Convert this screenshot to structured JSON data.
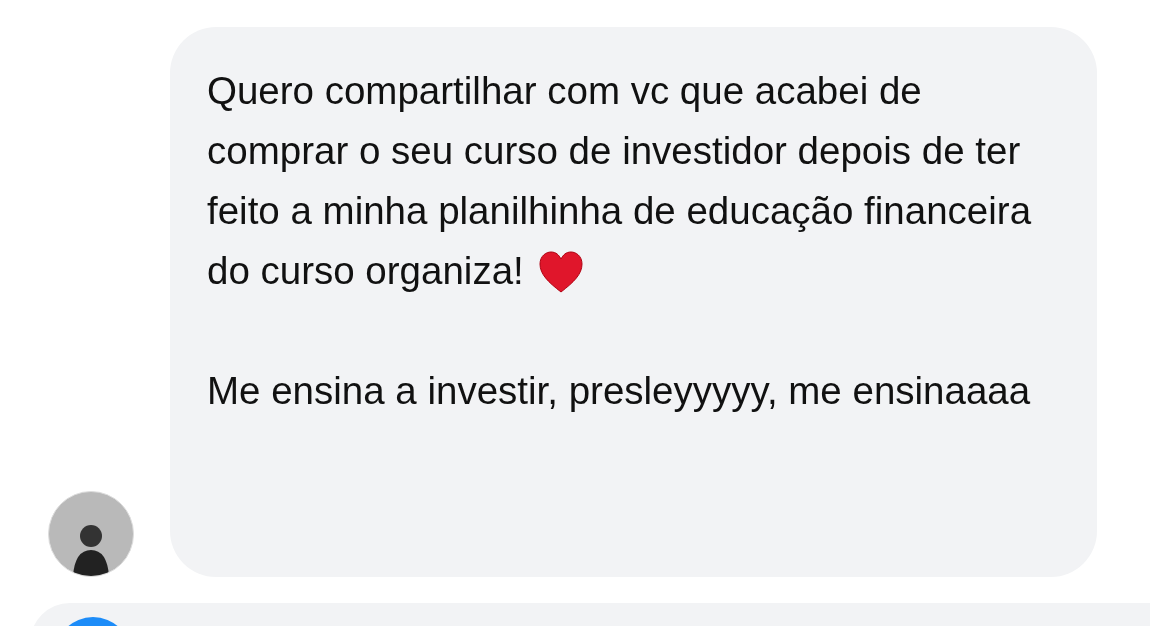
{
  "message": {
    "paragraphs": [
      "Quero compartilhar com vc que acabei de comprar o seu curso de investidor depois de ter feito a minha planilhinha de educação financeira do curso organiza!",
      "Me ensina a investir, presleyyyyy, me ensinaaaa"
    ]
  }
}
